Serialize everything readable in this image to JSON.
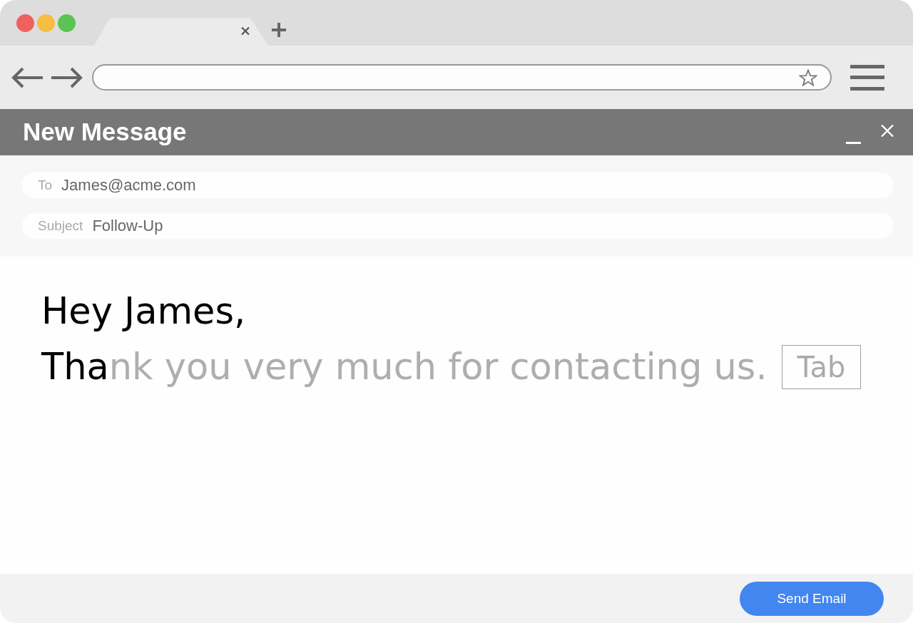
{
  "browser": {
    "tabs": [
      {
        "selected": true
      }
    ]
  },
  "compose": {
    "title": "New Message",
    "fields": [
      {
        "label": "To",
        "value": "James@acme.com"
      },
      {
        "label": "Subject",
        "value": "Follow-Up"
      }
    ],
    "body": {
      "greeting": "Hey James,",
      "typed": "Tha",
      "suggestion": "nk you very much for contacting us.",
      "key_hint": "Tab"
    },
    "send_button": "Send Email"
  }
}
